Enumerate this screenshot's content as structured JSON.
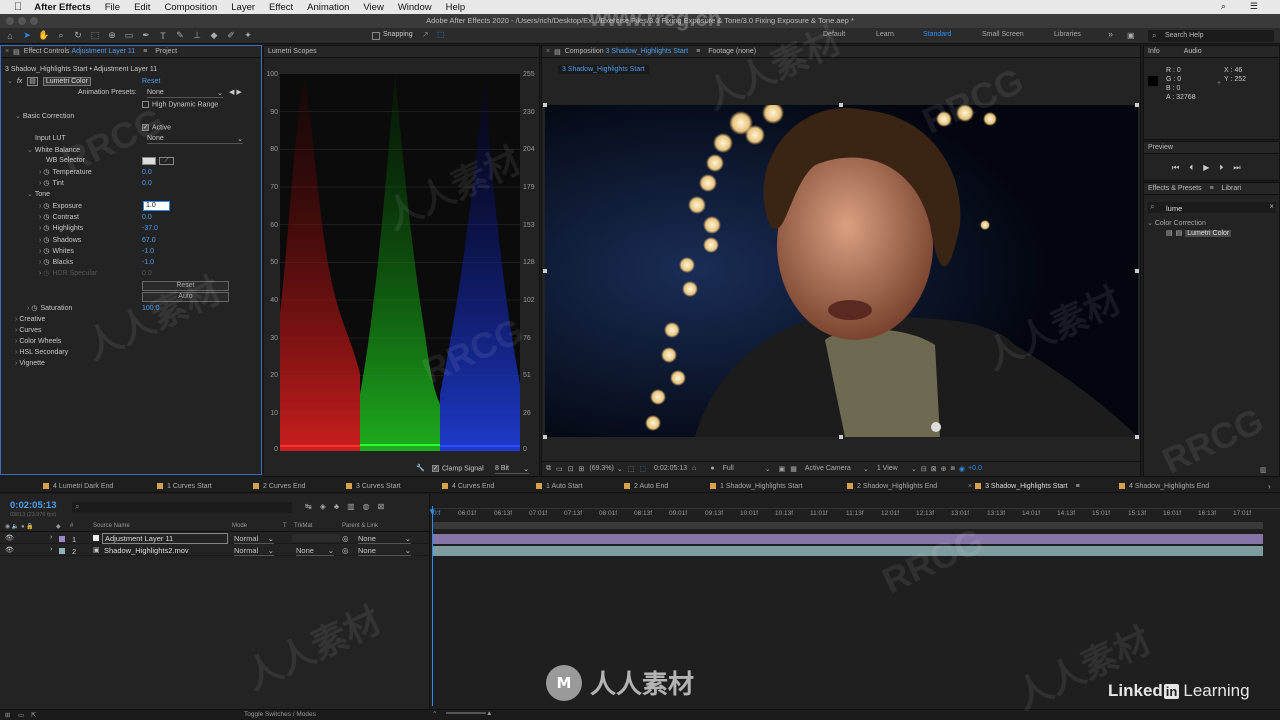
{
  "menubar": {
    "apple": "",
    "app": "After Effects",
    "items": [
      "File",
      "Edit",
      "Composition",
      "Layer",
      "Effect",
      "Animation",
      "View",
      "Window",
      "Help"
    ]
  },
  "titlebar": "Adobe After Effects 2020 - /Users/rich/Desktop/Ex.../Exercise Files/3.0 Fixing Exposure & Tone/3.0 Fixing Exposure & Tone.aep *",
  "toolbar": {
    "snapping": "Snapping",
    "workspaces": [
      "Default",
      "Learn",
      "Standard",
      "Small Screen",
      "Libraries"
    ],
    "active_workspace": "Standard",
    "search_placeholder": "Search Help"
  },
  "effect_controls": {
    "tab_label": "Effect Controls",
    "tab_layer": "Adjustment Layer 11",
    "project_tab": "Project",
    "breadcrumb": "3 Shadow_Highlights Start • Adjustment Layer 11",
    "effect_name": "Lumetri Color",
    "reset": "Reset",
    "animation_presets_label": "Animation Presets:",
    "animation_presets_value": "None",
    "hdr": "High Dynamic Range",
    "basic_correction": "Basic Correction",
    "active": "Active",
    "input_lut_label": "Input LUT",
    "input_lut_value": "None",
    "white_balance": "White Balance",
    "wb_selector": "WB Selector",
    "temperature_label": "Temperature",
    "temperature": "0.0",
    "tint_label": "Tint",
    "tint": "0.0",
    "tone": "Tone",
    "exposure_label": "Exposure",
    "exposure": "1.0",
    "contrast_label": "Contrast",
    "contrast": "0.0",
    "highlights_label": "Highlights",
    "highlights": "-37.0",
    "shadows_label": "Shadows",
    "shadows": "67.0",
    "whites_label": "Whites",
    "whites": "-1.0",
    "blacks_label": "Blacks",
    "blacks": "-1.0",
    "hdr_specular_label": "HDR Specular",
    "hdr_specular": "0.0",
    "reset_button": "Reset",
    "auto_button": "Auto",
    "saturation_label": "Saturation",
    "saturation": "100.0",
    "sections": [
      "Creative",
      "Curves",
      "Color Wheels",
      "HSL Secondary",
      "Vignette"
    ]
  },
  "scopes": {
    "tab": "Lumetri Scopes",
    "left_axis": [
      "100",
      "90",
      "80",
      "70",
      "60",
      "50",
      "40",
      "30",
      "20",
      "10",
      "0"
    ],
    "right_axis": [
      "255",
      "230",
      "204",
      "179",
      "153",
      "128",
      "102",
      "76",
      "51",
      "26",
      "0"
    ],
    "clamp": "Clamp Signal",
    "bit": "8 Bit"
  },
  "composition": {
    "tab_label": "Composition",
    "tab_comp": "3 Shadow_Highlights Start",
    "footage_tab": "Footage (none)",
    "subtab": "3 Shadow_Highlights Start",
    "zoom": "(69.3%)",
    "timecode": "0:02:05:13",
    "resolution": "Full",
    "camera": "Active Camera",
    "view": "1 View",
    "exposure_value": "+0.0"
  },
  "info": {
    "tab": "Info",
    "audio_tab": "Audio",
    "r": "R : 0",
    "g": "G : 0",
    "b": "B : 0",
    "a": "A : 32768",
    "x": "X : 46",
    "y": "Y : 252"
  },
  "preview": {
    "tab": "Preview"
  },
  "effects_presets": {
    "tab": "Effects & Presets",
    "libraries_tab": "Librari",
    "search": "lume",
    "category": "Color Correction",
    "item": "Lumetri Color"
  },
  "timeline": {
    "tabs": [
      "4 Lumetri Dark End",
      "1 Curves Start",
      "2 Curves End",
      "3 Curves Start",
      "4 Curves End",
      "1 Auto Start",
      "2 Auto End",
      "1 Shadow_Highlights Start",
      "2 Shadow_Highlights End",
      "3 Shadow_Highlights Start",
      "4 Shadow_Highlights End"
    ],
    "active_tab": "3 Shadow_Highlights Start",
    "timecode": "0:02:05:13",
    "fps": "03013 (23.976 fps)",
    "columns": {
      "source": "Source Name",
      "mode": "Mode",
      "t": "T",
      "trkmat": "TrkMat",
      "parent": "Parent & Link"
    },
    "layers": [
      {
        "num": "1",
        "name": "Adjustment Layer 11",
        "mode": "Normal",
        "trkmat": "",
        "parent": "None",
        "color": "#9b86c8"
      },
      {
        "num": "2",
        "name": "Shadow_Highlights2.mov",
        "mode": "Normal",
        "trkmat": "None",
        "parent": "None",
        "color": "#8fb2b8"
      }
    ],
    "ruler": [
      "0:f",
      "06:01f",
      "06:13f",
      "07:01f",
      "07:13f",
      "08:01f",
      "08:13f",
      "09:01f",
      "09:13f",
      "10:01f",
      "10:13f",
      "11:01f",
      "11:13f",
      "12:01f",
      "12:13f",
      "13:01f",
      "13:13f",
      "14:01f",
      "14:13f",
      "15:01f",
      "15:13f",
      "16:01f",
      "16:13f",
      "17:01f"
    ],
    "toggle": "Toggle Switches / Modes"
  },
  "watermarks": {
    "site": "www.rrcg.cn",
    "brand_a": "RRCG",
    "brand_b": "人人素材",
    "linkedin": "Linked",
    "learning": "Learning",
    "in": "in"
  },
  "colors": {
    "accent": "#2d8ceb",
    "red": "#e02020",
    "green": "#20c020",
    "blue": "#2040e0"
  }
}
